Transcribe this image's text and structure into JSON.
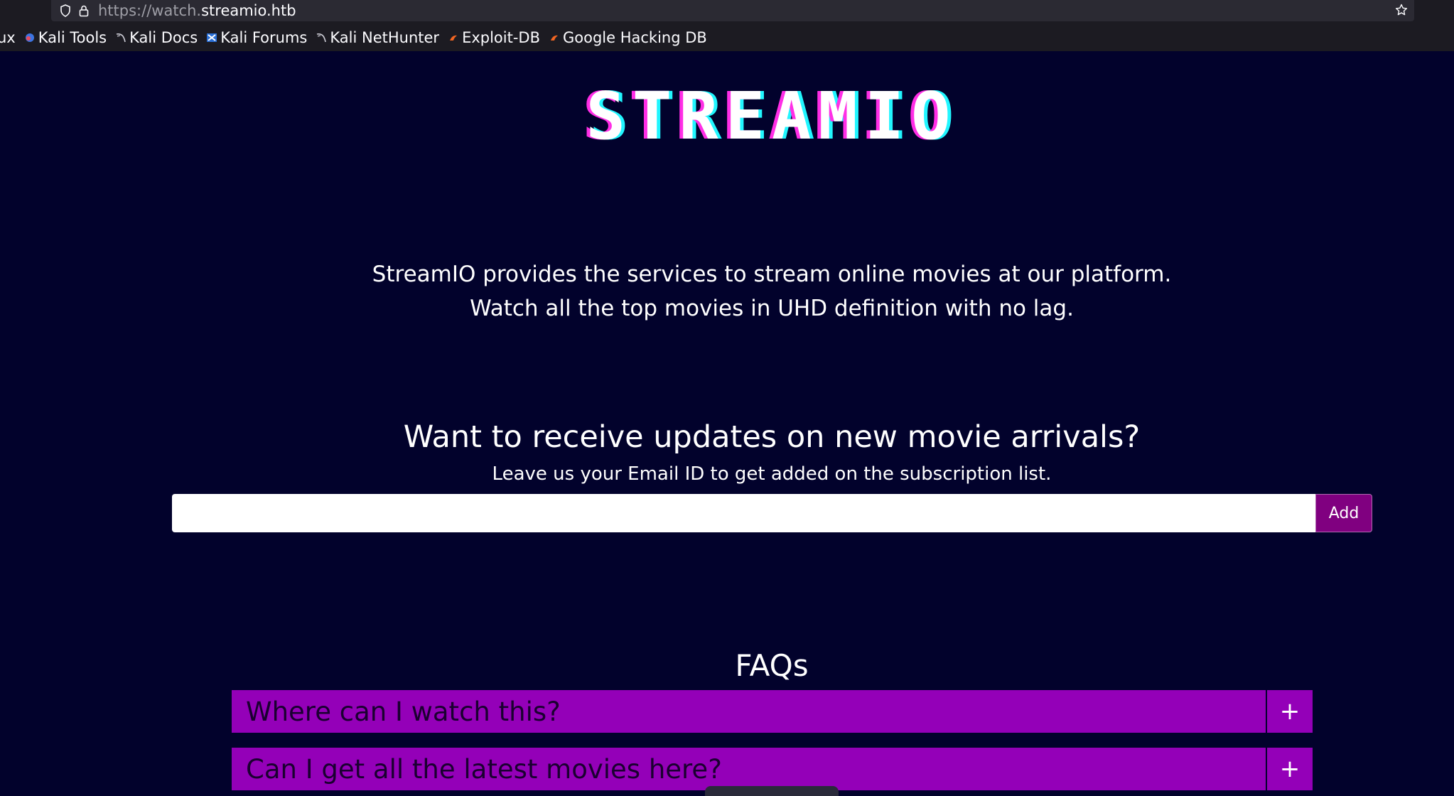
{
  "browser": {
    "url_prefix": "https://watch.",
    "url_domain": "streamio.htb",
    "bookmarks": [
      {
        "label": "ux",
        "icon": "truncated-bookmark"
      },
      {
        "label": "Kali Tools",
        "icon": "kali-tools-icon"
      },
      {
        "label": "Kali Docs",
        "icon": "kali-dragon-icon"
      },
      {
        "label": "Kali Forums",
        "icon": "kali-forums-icon"
      },
      {
        "label": "Kali NetHunter",
        "icon": "kali-dragon-icon"
      },
      {
        "label": "Exploit-DB",
        "icon": "exploit-db-icon"
      },
      {
        "label": "Google Hacking DB",
        "icon": "exploit-db-icon"
      }
    ]
  },
  "page": {
    "logo": "STREAMIO",
    "intro_line1": "StreamIO provides the services to stream online movies at our platform.",
    "intro_line2": "Watch all the top movies in UHD definition with no lag.",
    "subscribe_title": "Want to receive updates on new movie arrivals?",
    "subscribe_subtitle": "Leave us your Email ID to get added on the subscription list.",
    "email_value": "",
    "add_label": "Add",
    "faq_title": "FAQs",
    "faqs": [
      {
        "question": "Where can I watch this?",
        "toggle": "+"
      },
      {
        "question": "Can I get all the latest movies here?",
        "toggle": "+"
      }
    ]
  },
  "colors": {
    "background": "#02022c",
    "accent": "#9400b8",
    "add_button": "#800080",
    "logo_shadow_left": "#ff2ee6",
    "logo_shadow_right": "#21f6ff"
  }
}
